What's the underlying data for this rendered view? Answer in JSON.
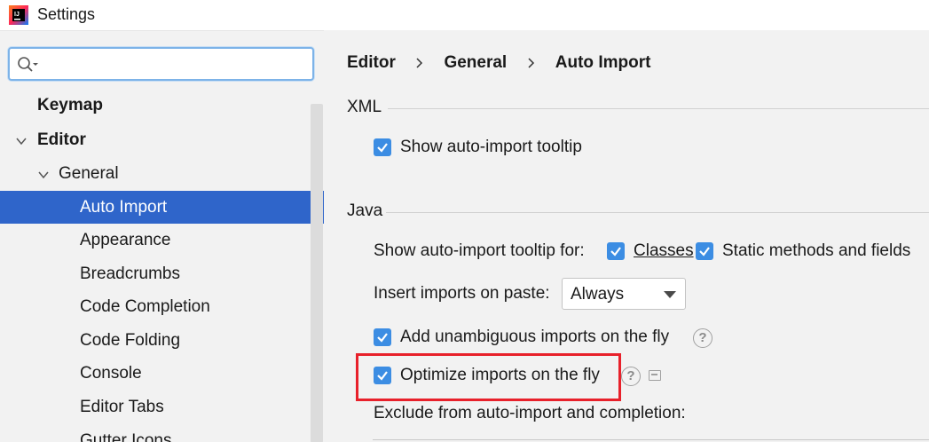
{
  "window": {
    "title": "Settings",
    "icon": "intellij-idea-icon"
  },
  "search": {
    "value": "",
    "placeholder": ""
  },
  "tree": {
    "keymap": "Keymap",
    "editor": "Editor",
    "general": "General",
    "items": [
      "Auto Import",
      "Appearance",
      "Breadcrumbs",
      "Code Completion",
      "Code Folding",
      "Console",
      "Editor Tabs",
      "Gutter Icons"
    ],
    "selected": "Auto Import"
  },
  "breadcrumb": [
    "Editor",
    "General",
    "Auto Import"
  ],
  "xml": {
    "title": "XML",
    "show_tooltip": {
      "label": "Show auto-import tooltip",
      "checked": true
    }
  },
  "java": {
    "title": "Java",
    "tooltip_for_label": "Show auto-import tooltip for:",
    "classes": {
      "label": "Classes",
      "checked": true
    },
    "static_methods": {
      "label": "Static methods and fields",
      "checked": true
    },
    "insert_on_paste_label": "Insert imports on paste:",
    "insert_on_paste_value": "Always",
    "add_unambiguous": {
      "label": "Add unambiguous imports on the fly",
      "checked": true
    },
    "optimize": {
      "label": "Optimize imports on the fly",
      "checked": true
    },
    "exclude_label": "Exclude from auto-import and completion:"
  },
  "colors": {
    "accent": "#3c8de3",
    "selection": "#2f65ca",
    "highlight": "#e8212b"
  }
}
